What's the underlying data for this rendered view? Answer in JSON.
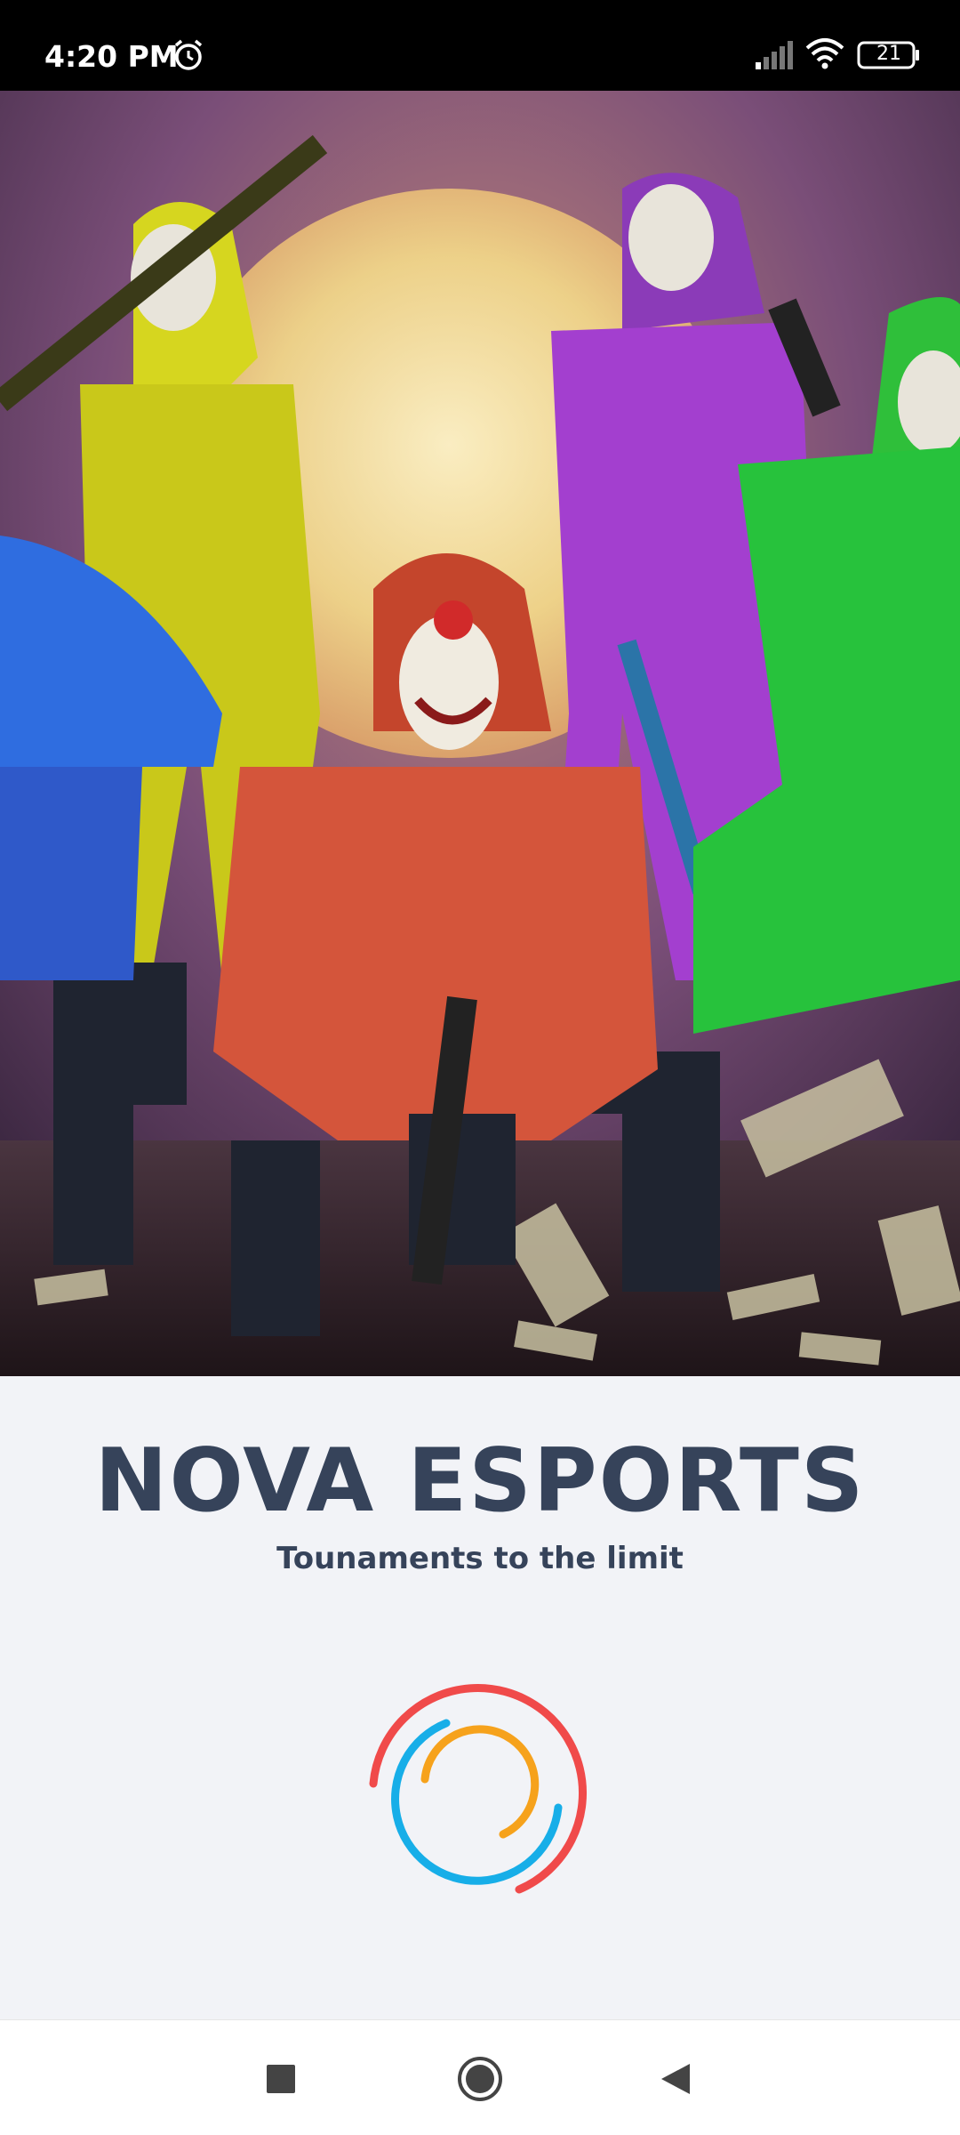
{
  "status_bar": {
    "time": "4:20 PM",
    "battery": "21",
    "icons": [
      "alarm-icon",
      "signal-icon",
      "wifi-icon",
      "battery-icon"
    ]
  },
  "hero": {
    "description_icon": "hero-illustration"
  },
  "brand": {
    "title": "NOVA ESPORTS",
    "tagline": "Tounaments to the limit"
  },
  "loader": {
    "colors": [
      "#f04a4a",
      "#17aee8",
      "#f6a21c"
    ]
  },
  "nav_bar": {
    "buttons": [
      "recents-icon",
      "home-icon",
      "back-icon"
    ]
  },
  "colors": {
    "title_text": "#36435a",
    "background": "#f2f3f7"
  }
}
